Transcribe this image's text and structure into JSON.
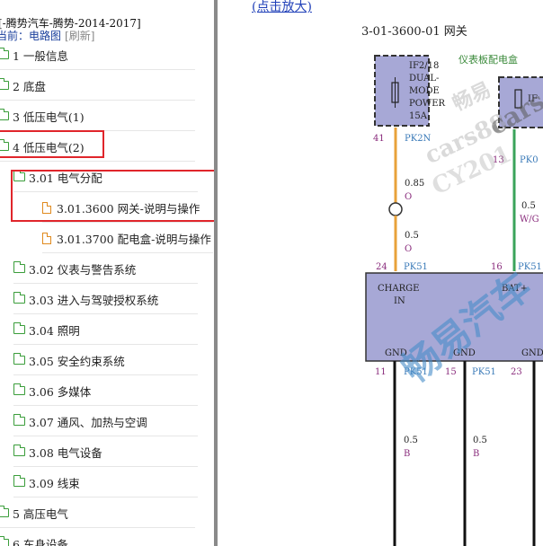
{
  "sidebar": {
    "title": "[-腾势汽车-腾势-2014-2017]",
    "current_label": "当前：",
    "current_link": "电路图",
    "refresh": "[刷新]",
    "items": [
      {
        "label": "1 一般信息"
      },
      {
        "label": "2 底盘"
      },
      {
        "label": "3 低压电气(1)"
      },
      {
        "label": "4 低压电气(2)"
      },
      {
        "label": "3.01 电气分配"
      },
      {
        "label": "3.01.3600 网关-说明与操作"
      },
      {
        "label": "3.01.3700 配电盒-说明与操作"
      },
      {
        "label": "3.02 仪表与警告系统"
      },
      {
        "label": "3.03 进入与驾驶授权系统"
      },
      {
        "label": "3.04 照明"
      },
      {
        "label": "3.05 安全约束系统"
      },
      {
        "label": "3.06 多媒体"
      },
      {
        "label": "3.07 通风、加热与空调"
      },
      {
        "label": "3.08 电气设备"
      },
      {
        "label": "3.09 线束"
      },
      {
        "label": "5 高压电气"
      },
      {
        "label": "6 车身设备"
      }
    ]
  },
  "main": {
    "zoom_link": "(点击放大)",
    "diagram_title": "3-01-3600-01 网关",
    "panel_label": "仪表板配电盒",
    "fuse": {
      "line1": "IF2/18",
      "line2": "DUAL-",
      "line3": "MODE",
      "line4": "POWER",
      "line5": "15A",
      "partial": "IF"
    },
    "pins": {
      "p41": "41",
      "pk2n": "PK2N",
      "p13": "13",
      "pk0": "PK0",
      "p24": "24",
      "pk51_a": "PK51",
      "p16": "16",
      "pk51_b": "PK51",
      "p11": "11",
      "pk51_c": "PK51",
      "p15": "15",
      "pk51_d": "PK51",
      "p23": "23"
    },
    "wires": {
      "w1_gauge": "0.85",
      "w1_color": "O",
      "w2_gauge": "0.5",
      "w2_color": "O",
      "w3_gauge": "0.5",
      "w3_color": "W/G",
      "w4_gauge": "0.5",
      "w4_color": "B",
      "w5_gauge": "0.5",
      "w5_color": "B"
    },
    "module": {
      "charge": "CHARGE",
      "in": "IN",
      "bat": "BAT+",
      "gnd1": "GND",
      "gnd2": "GND",
      "gnd3": "GND"
    },
    "watermarks": {
      "w1": "畅易",
      "w2": "cars88",
      "w3": "CY201",
      "w4": "畅易汽车",
      "w5": "cars"
    },
    "colors": {
      "orange_wire": "#e8a23a",
      "green_wire": "#3aa35a",
      "module_fill": "#a7a8d6",
      "fuse_fill": "#a7a8d6"
    }
  }
}
